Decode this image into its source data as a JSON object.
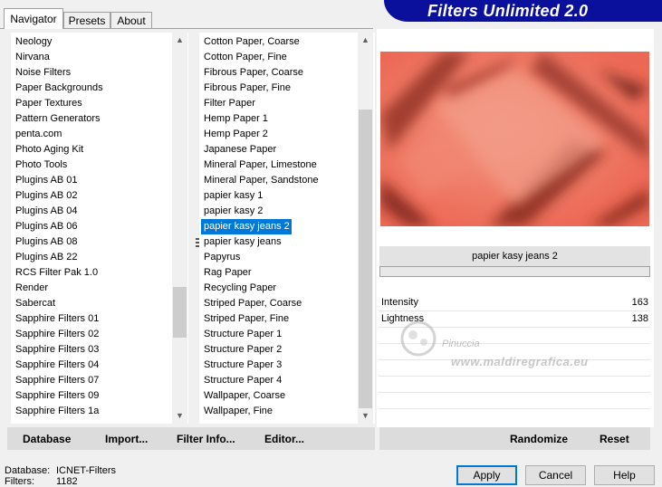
{
  "tabs": [
    {
      "label": "Navigator",
      "active": true
    },
    {
      "label": "Presets",
      "active": false
    },
    {
      "label": "About",
      "active": false
    }
  ],
  "banner": {
    "title": "Filters Unlimited 2.0",
    "color": "#0a0f9c"
  },
  "categories": [
    "Neology",
    "Nirvana",
    "Noise Filters",
    "Paper Backgrounds",
    "Paper Textures",
    "Pattern Generators",
    "penta.com",
    "Photo Aging Kit",
    "Photo Tools",
    "Plugins AB 01",
    "Plugins AB 02",
    "Plugins AB 04",
    "Plugins AB 06",
    "Plugins AB 08",
    "Plugins AB 22",
    "RCS Filter Pak 1.0",
    "Render",
    "Sabercat",
    "Sapphire Filters 01",
    "Sapphire Filters 02",
    "Sapphire Filters 03",
    "Sapphire Filters 04",
    "Sapphire Filters 07",
    "Sapphire Filters 09",
    "Sapphire Filters 1a"
  ],
  "filters": [
    "Cotton Paper, Coarse",
    "Cotton Paper, Fine",
    "Fibrous Paper, Coarse",
    "Fibrous Paper, Fine",
    "Filter Paper",
    "Hemp Paper 1",
    "Hemp Paper 2",
    "Japanese Paper",
    "Mineral Paper, Limestone",
    "Mineral Paper, Sandstone",
    "papier kasy 1",
    "papier kasy 2",
    "papier kasy jeans 2",
    "papier kasy jeans",
    "Papyrus",
    "Rag Paper",
    "Recycling Paper",
    "Striped Paper, Coarse",
    "Striped Paper, Fine",
    "Structure Paper 1",
    "Structure Paper 2",
    "Structure Paper 3",
    "Structure Paper 4",
    "Wallpaper, Coarse",
    "Wallpaper, Fine"
  ],
  "selected_filter_index": 12,
  "current_filter": "papier kasy jeans 2",
  "params": [
    {
      "label": "Intensity",
      "value": "163"
    },
    {
      "label": "Lightness",
      "value": "138"
    }
  ],
  "watermark": {
    "line1": "Pinuccia",
    "line2": "www.maldiregrafica.eu"
  },
  "toolbar": {
    "database": "Database",
    "import": "Import...",
    "filter_info": "Filter Info...",
    "editor": "Editor...",
    "randomize": "Randomize",
    "reset": "Reset"
  },
  "status": {
    "database_label": "Database:",
    "database_value": "ICNET-Filters",
    "filters_label": "Filters:",
    "filters_value": "1182"
  },
  "buttons": {
    "apply": "Apply",
    "cancel": "Cancel",
    "help": "Help"
  },
  "colors": {
    "selection": "#0078d7",
    "preview_base": "#f26a55"
  }
}
